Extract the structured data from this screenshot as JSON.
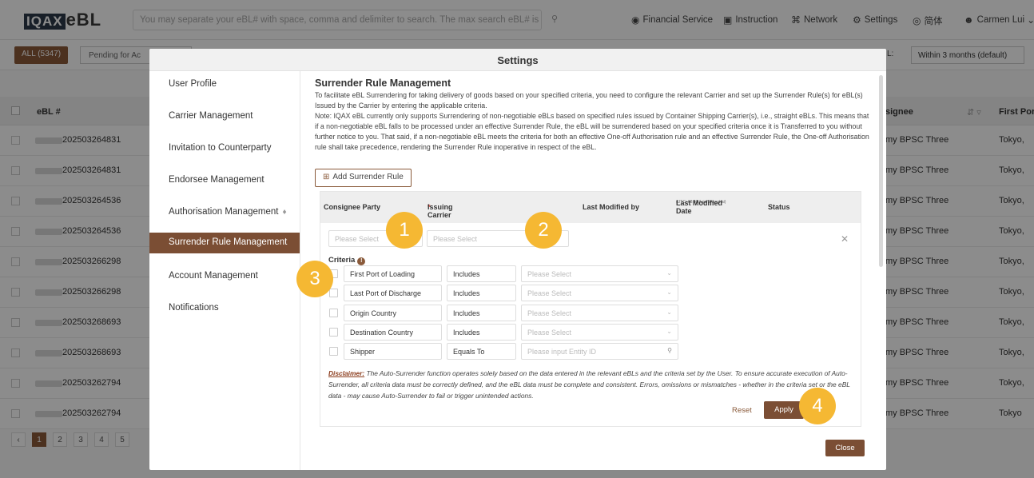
{
  "app": {
    "logo_box": "IQAX",
    "logo_text": "eBL",
    "search_placeholder": "You may separate your eBL# with space, comma and delimiter to search. The max search eBL# is 50.",
    "nav": {
      "financial": "Financial Service",
      "instruction": "Instruction",
      "network": "Network",
      "settings": "Settings",
      "language": "简体",
      "user": "Carmen Lui"
    },
    "tab_all": "ALL (5347)",
    "tab_pending": "Pending for Ac",
    "date_filter_label": "L:",
    "date_filter_value": "Within 3 months (default)",
    "columns": {
      "ebl": "eBL #",
      "consignee": "signee",
      "first_port": "First Port"
    },
    "rows": [
      {
        "ebl": "202503264831",
        "consignee": "my BPSC Three",
        "city": "Tokyo,"
      },
      {
        "ebl": "202503264831",
        "consignee": "my BPSC Three",
        "city": "Tokyo,"
      },
      {
        "ebl": "202503264536",
        "consignee": "my BPSC Three",
        "city": "Tokyo,"
      },
      {
        "ebl": "202503264536",
        "consignee": "my BPSC Three",
        "city": "Tokyo,"
      },
      {
        "ebl": "202503266298",
        "consignee": "my BPSC Three",
        "city": "Tokyo,"
      },
      {
        "ebl": "202503266298",
        "consignee": "my BPSC Three",
        "city": "Tokyo,"
      },
      {
        "ebl": "202503268693",
        "consignee": "my BPSC Three",
        "city": "Tokyo,"
      },
      {
        "ebl": "202503268693",
        "consignee": "my BPSC Three",
        "city": "Tokyo,"
      },
      {
        "ebl": "202503262794",
        "consignee": "my BPSC Three",
        "city": "Tokyo,"
      },
      {
        "ebl": "202503262794",
        "consignee": "my BPSC Three",
        "city": "Tokyo"
      }
    ],
    "pages": [
      "1",
      "2",
      "3",
      "4",
      "5"
    ]
  },
  "modal": {
    "title": "Settings",
    "sidebar": [
      "User Profile",
      "Carrier Management",
      "Invitation to Counterparty",
      "Endorsee Management",
      "Authorisation Management",
      "Surrender Rule Management",
      "Account Management",
      "Notifications"
    ],
    "section_title": "Surrender Rule Management",
    "desc_1": "To facilitate eBL Surrendering for taking delivery of goods based on your specified criteria, you need to configure the relevant Carrier and set up the Surrender Rule(s) for eBL(s) Issued by the Carrier by entering the applicable criteria.",
    "desc_2": "Note: IQAX eBL currently only supports Surrendering of non-negotiable eBLs based on specified rules issued by Container Shipping Carrier(s), i.e., straight eBLs. This means that if a non-negotiable eBL falls to be processed under an effective Surrender Rule, the eBL will be surrendered based on your specified criteria once it is Transferred to you without further notice to you. That said, if a non-negotiable eBL meets the criteria for both an effective One-off Authorisation rule and an effective Surrender Rule, the One-off Authorisation rule shall take precedence, rendering the Surrender Rule inoperative in respect of the eBL.",
    "add_rule": "Add Surrender Rule",
    "table_headers": {
      "consignee": "Consignee Party",
      "carrier": "Issuing Carrier",
      "modified_by": "Last Modified by",
      "modified_date": "Last Modified Date",
      "modified_tz": "(UTC+08:00 Asia/Shanghai)",
      "status": "Status"
    },
    "please_select": "Please Select",
    "criteria_label": "Criteria",
    "criteria": [
      {
        "field": "First Port of Loading",
        "op": "Includes",
        "value": "Please Select"
      },
      {
        "field": "Last Port of Discharge",
        "op": "Includes",
        "value": "Please Select"
      },
      {
        "field": "Origin Country",
        "op": "Includes",
        "value": "Please Select"
      },
      {
        "field": "Destination Country",
        "op": "Includes",
        "value": "Please Select"
      },
      {
        "field": "Shipper",
        "op": "Equals To",
        "value": "Please input Entity ID"
      }
    ],
    "disclaimer_label": "Disclaimer:",
    "disclaimer": " The Auto-Surrender function operates solely based on the data entered in the relevant eBLs and the criteria set by the User. To ensure accurate execution of Auto-Surrender, all criteria data must be correctly defined, and the eBL data must be complete and consistent. Errors, omissions or mismatches - whether in the criteria set or the eBL data - may cause Auto-Surrender to fail or trigger unintended actions.",
    "reset": "Reset",
    "apply": "Apply",
    "close": "Close"
  },
  "markers": [
    "1",
    "2",
    "3",
    "4"
  ],
  "colors": {
    "brand": "#7b4e34",
    "marker": "#f5b833"
  }
}
